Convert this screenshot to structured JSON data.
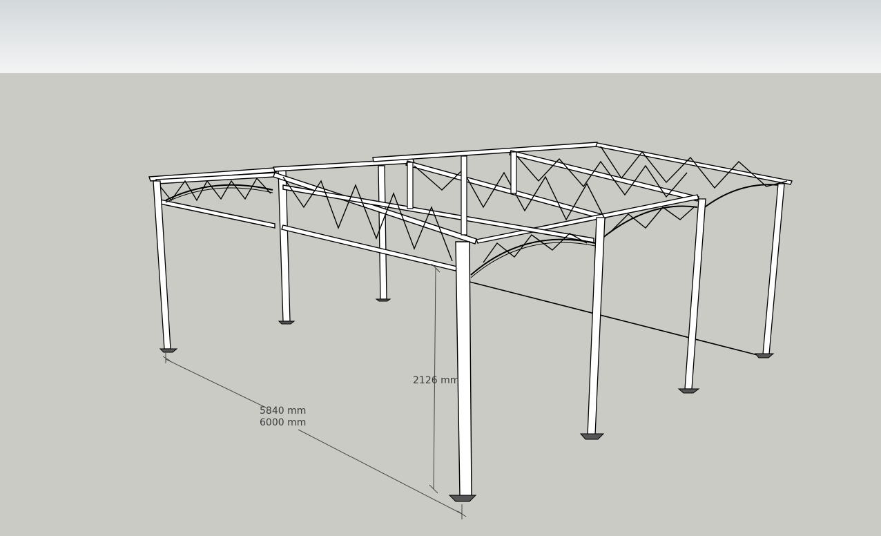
{
  "scene": {
    "sky_color": "#e6e9ea",
    "ground_color": "#cbcbc6",
    "structure_color": "#ffffff",
    "outline_color": "#000000",
    "dimension_color": "#444444"
  },
  "dimensions": {
    "height_label": "2126 mm",
    "depth_label_inner": "5840 mm",
    "depth_label_outer": "6000 mm"
  }
}
